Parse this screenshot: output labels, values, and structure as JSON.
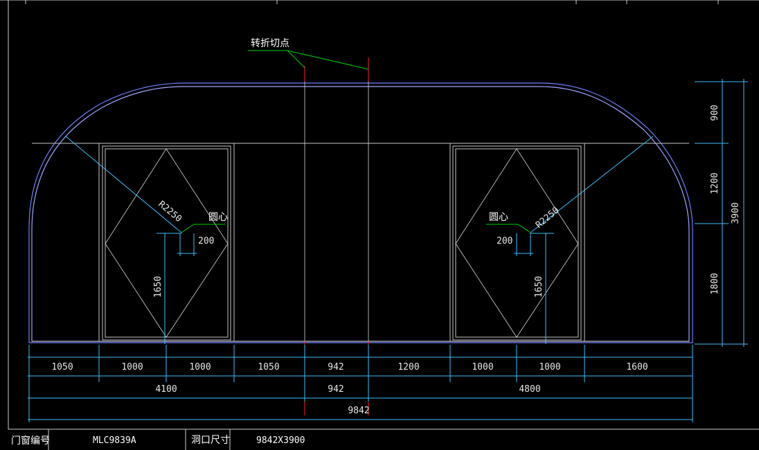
{
  "colors": {
    "background": "#000000",
    "outline": "#7080ff",
    "frame": "#d0d0d0",
    "dimension": "#3fc0ff",
    "leader": "#00d000",
    "center_mark": "#ff2020",
    "text": "#ffffff"
  },
  "annotation": {
    "break_point": "转折切点",
    "center_left": "圆心",
    "center_right": "圆心"
  },
  "dimensions": {
    "radius_left": "R2250",
    "radius_right": "R2250",
    "offset_left": "200",
    "offset_right": "200",
    "height_left": "1650",
    "height_right": "1650",
    "bottom_row1": [
      "1050",
      "1000",
      "1000",
      "1050",
      "942",
      "1200",
      "1000",
      "1000",
      "1600"
    ],
    "bottom_row2": [
      "4100",
      "942",
      "4800"
    ],
    "bottom_total": "9842",
    "right_segments": [
      "900",
      "1200",
      "1800"
    ],
    "right_total": "3900"
  },
  "title_block": {
    "window_code_label": "门窗编号",
    "window_code": "MLC9839A",
    "opening_size_label": "洞口尺寸",
    "opening_size": "9842X3900"
  }
}
